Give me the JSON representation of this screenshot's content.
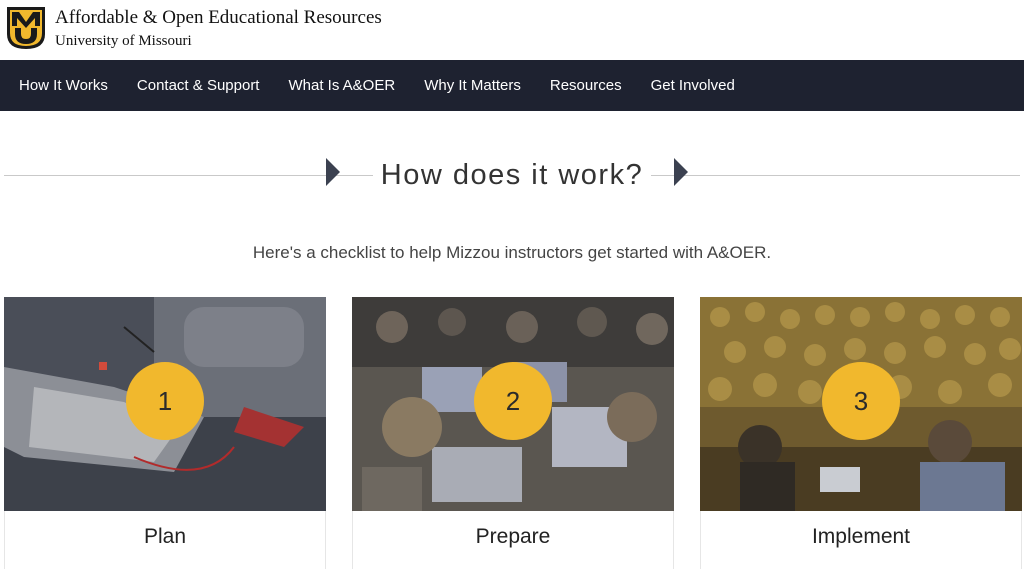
{
  "header": {
    "title": "Affordable & Open Educational Resources",
    "subtitle": "University of Missouri",
    "logo_text": "MU"
  },
  "nav": {
    "items": [
      {
        "label": "How It Works"
      },
      {
        "label": "Contact & Support"
      },
      {
        "label": "What Is A&OER"
      },
      {
        "label": "Why It Matters"
      },
      {
        "label": "Resources"
      },
      {
        "label": "Get Involved"
      }
    ]
  },
  "main": {
    "headline": "How does it work?",
    "intro": "Here's a checklist to help Mizzou instructors get started with A&OER.",
    "steps": [
      {
        "number": "1",
        "label": "Plan"
      },
      {
        "number": "2",
        "label": "Prepare"
      },
      {
        "number": "3",
        "label": "Implement"
      }
    ]
  },
  "colors": {
    "nav_bg": "#1e2230",
    "accent_gold": "#f1b82d"
  }
}
